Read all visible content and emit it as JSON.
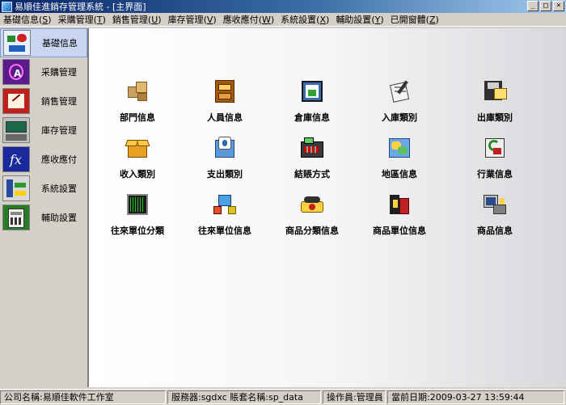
{
  "window": {
    "title": "易順佳進銷存管理系統 - [主界面]"
  },
  "menu": [
    {
      "label": "基礎信息",
      "key": "S"
    },
    {
      "label": "采購管理",
      "key": "T"
    },
    {
      "label": "銷售管理",
      "key": "U"
    },
    {
      "label": "庫存管理",
      "key": "V"
    },
    {
      "label": "應收應付",
      "key": "W"
    },
    {
      "label": "系統設置",
      "key": "X"
    },
    {
      "label": "輔助設置",
      "key": "Y"
    },
    {
      "label": "已開窗體",
      "key": "Z"
    }
  ],
  "sidebar": {
    "items": [
      {
        "label": "基礎信息",
        "icon": "basic-info-icon",
        "active": true
      },
      {
        "label": "采購管理",
        "icon": "purchase-icon"
      },
      {
        "label": "銷售管理",
        "icon": "sales-icon"
      },
      {
        "label": "庫存管理",
        "icon": "inventory-icon"
      },
      {
        "label": "應收應付",
        "icon": "receivable-payable-icon"
      },
      {
        "label": "系統設置",
        "icon": "system-settings-icon"
      },
      {
        "label": "輔助設置",
        "icon": "auxiliary-settings-icon"
      }
    ]
  },
  "tiles": [
    {
      "label": "部門信息",
      "icon": "boxes-icon"
    },
    {
      "label": "人員信息",
      "icon": "cabinet-icon"
    },
    {
      "label": "倉庫信息",
      "icon": "picture-icon"
    },
    {
      "label": "入庫類別",
      "icon": "clipboard-icon"
    },
    {
      "label": "出庫類別",
      "icon": "disk-icon"
    },
    {
      "label": "收入類別",
      "icon": "open-box-icon"
    },
    {
      "label": "支出類別",
      "icon": "folder-icon"
    },
    {
      "label": "結賬方式",
      "icon": "register-icon"
    },
    {
      "label": "地區信息",
      "icon": "map-icon"
    },
    {
      "label": "行業信息",
      "icon": "recycle-icon"
    },
    {
      "label": "往來單位分類",
      "icon": "oscilloscope-icon"
    },
    {
      "label": "往來單位信息",
      "icon": "network-icon"
    },
    {
      "label": "商品分類信息",
      "icon": "phone-icon"
    },
    {
      "label": "商品單位信息",
      "icon": "bricks-icon"
    },
    {
      "label": "商品信息",
      "icon": "computer-icon"
    }
  ],
  "status": {
    "company": "公司名稱:易順佳軟件工作室",
    "server": "服務器:sgdxc  賬套名稱:sp_data",
    "operator": "操作員:管理員",
    "date": "當前日期:2009-03-27 13:59:44"
  }
}
